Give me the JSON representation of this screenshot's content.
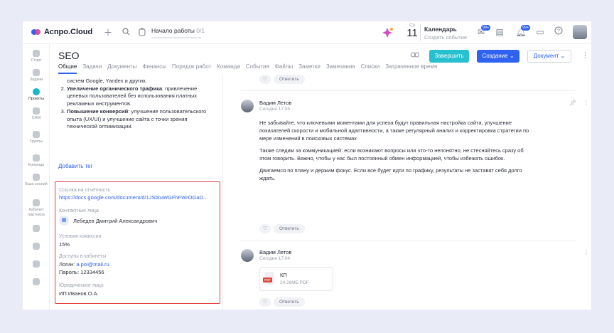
{
  "app": {
    "name": "Аспро.Cloud",
    "worktime_label": "Начало работы",
    "worktime_count": "0/1"
  },
  "calendar": {
    "weekday": "Ср",
    "day": "11",
    "title": "Календарь",
    "subtitle": "Создать событие"
  },
  "notifications": [
    {
      "icon": "inbox-icon",
      "badge": "99+"
    },
    {
      "icon": "tasks-icon",
      "badge": ""
    },
    {
      "icon": "bell-icon",
      "badge": "99+"
    },
    {
      "icon": "chat-icon",
      "badge": ""
    },
    {
      "icon": "help-icon",
      "badge": ""
    }
  ],
  "sidebar": {
    "items": [
      {
        "label": "Старт"
      },
      {
        "label": "Задачи"
      },
      {
        "label": "Проекты"
      },
      {
        "label": "CRM"
      },
      {
        "label": "Группы"
      },
      {
        "label": "Команда"
      },
      {
        "label": "База знаний"
      },
      {
        "label": "Кабинет партнера"
      }
    ]
  },
  "project": {
    "title": "SEO",
    "tabs": [
      "Общие",
      "Задачи",
      "Документы",
      "Финансы",
      "Порядок работ",
      "Команда",
      "События",
      "Файлы",
      "Заметки",
      "Замечания",
      "Списки",
      "Затраченное время"
    ],
    "finish_button": "Завершить",
    "create_button": "Создание",
    "document_button": "Документ"
  },
  "description": {
    "line0": "систем Google, Yandex и других.",
    "items": [
      {
        "bold": "Увеличение органического трафика",
        "text": ": привлечение целевых пользователей без использования платных рекламных инструментов."
      },
      {
        "bold": "Повышение конверсий",
        "text": ": улучшение пользовательского опыта (UX/UI) и улучшение сайта с точки зрения технической оптимизации."
      }
    ],
    "add_tag": "Добавить тег"
  },
  "properties": {
    "report_link_label": "Ссылка на отчетность",
    "report_link_value": "https://docs.google.com/document/d/1JSbtuWGFhFWrOGaD...",
    "contacts_label": "Контактные лица",
    "contact_name": "Лебедев Дмитрий Александрович",
    "commission_label": "Условия комиссии",
    "commission_value": "15%",
    "access_label": "Доступы в кабинеты",
    "login_prefix": "Логин: ",
    "login_email": "a.poi@mail.ru",
    "password": "Пароль: 12334456",
    "legal_label": "Юридическое лицо",
    "legal_value": "ИП Иванов О.А."
  },
  "feed": {
    "like_icon": "heart-icon",
    "reply_label": "Ответить",
    "posts": [
      {
        "author": "Вадим Летов",
        "time": "Сегодня 17:05",
        "paragraphs": [
          "Не забывайте, что ключевыми моментами для успеха будут правильная настройка сайта, улучшение показателей скорости и мобильной адаптивности, а также регулярный анализ и корректировка стратегии по мере изменений в поисковых системах",
          "Также следим за коммуникацией: если возникают вопросы или что-то непонятно, не стесняйтесь сразу об этом говорить. Важно, чтобы у нас был постоянный обмен информацией, чтобы избежать ошибок.",
          "Двигаемся по плану и держим фокус. Если все будет идти по графику, результаты не заставят себя долго ждать."
        ]
      },
      {
        "author": "Вадим Летов",
        "time": "Сегодня 17:04",
        "file": {
          "name": "КП",
          "size": "24.26МБ PDF",
          "type": "PDF"
        }
      }
    ]
  },
  "colors": {
    "accent": "#2f62f0",
    "teal": "#26c0cf",
    "highlight": "#e23b3b"
  }
}
